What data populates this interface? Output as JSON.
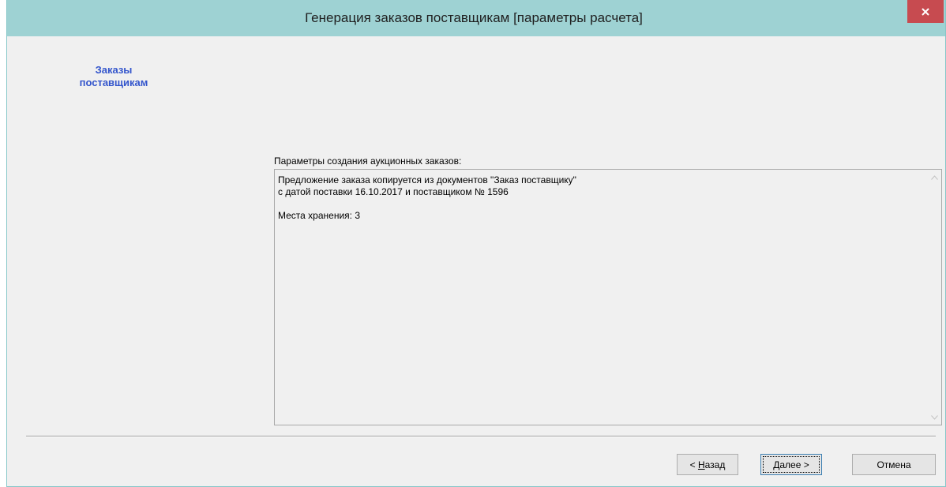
{
  "window": {
    "title": "Генерация заказов поставщикам [параметры расчета]",
    "close_icon": "close-icon"
  },
  "sidebar": {
    "heading_line1": "Заказы",
    "heading_line2": "поставщикам"
  },
  "params": {
    "label": "Параметры создания аукционных заказов:",
    "text": "Предложение заказа копируется из документов \"Заказ поставщику\"\nс датой поставки 16.10.2017 и поставщиком № 1596\n\nМеста хранения: 3"
  },
  "buttons": {
    "back_prefix": "< ",
    "back_mnemonic": "Н",
    "back_rest": "азад",
    "next_mnemonic": "Д",
    "next_rest": "алее >",
    "cancel": "Отмена"
  },
  "colors": {
    "titlebar": "#9ed2d3",
    "close": "#c74b50",
    "heading": "#3355cc"
  }
}
